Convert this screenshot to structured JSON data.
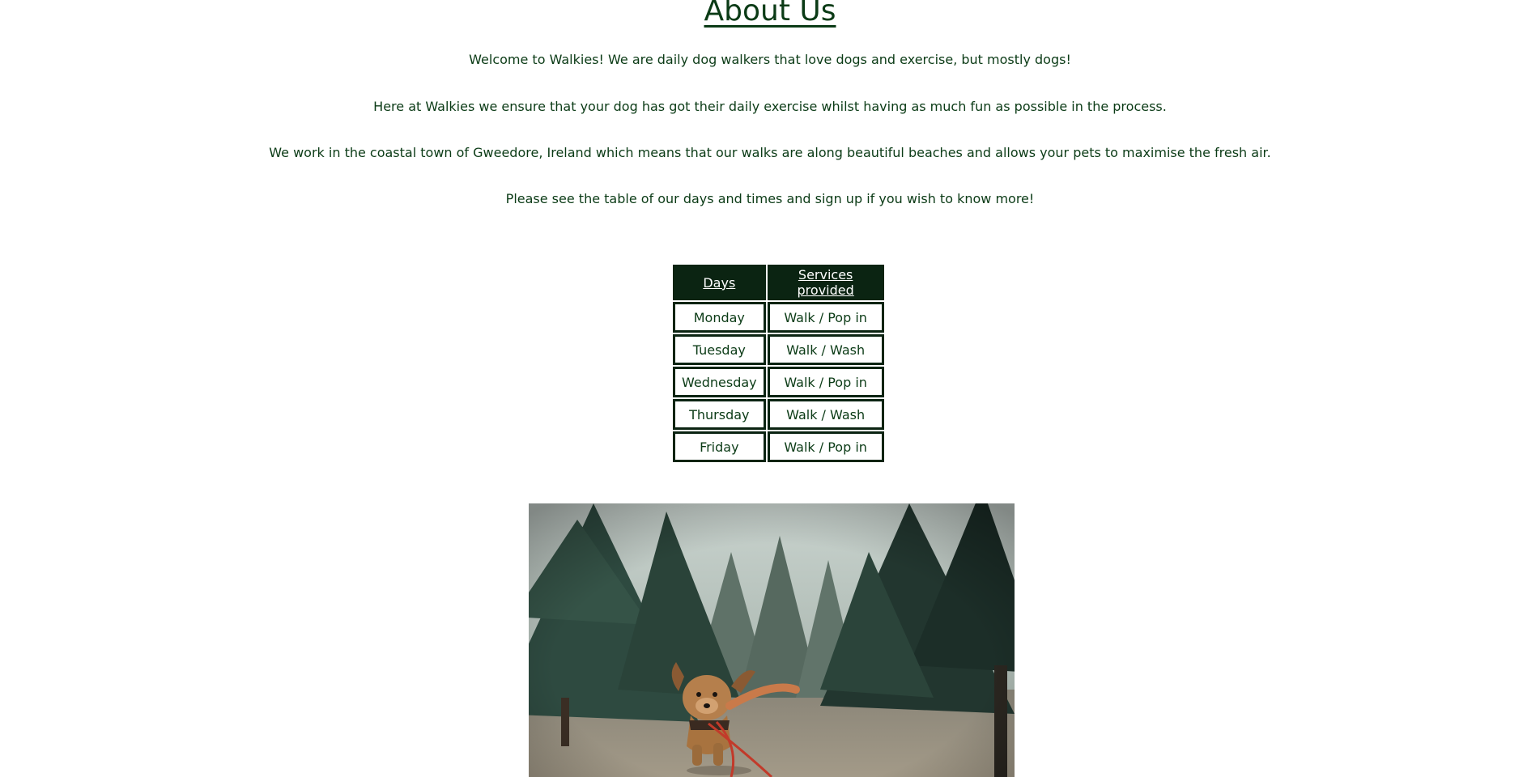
{
  "page": {
    "title": "About Us",
    "paragraphs": [
      "Welcome to Walkies! We are daily dog walkers that love dogs and exercise, but mostly dogs!",
      "Here at Walkies we ensure that your dog has got their daily exercise whilst having as much fun as possible in the process.",
      "We work in the coastal town of Gweedore, Ireland which means that our walks are along beautiful beaches and allows your pets to maximise the fresh air.",
      "Please see the table of our days and times and sign up if you wish to know more!"
    ]
  },
  "schedule": {
    "headers": [
      "Days",
      "Services provided"
    ],
    "rows": [
      {
        "day": "Monday",
        "service": "Walk / Pop in"
      },
      {
        "day": "Tuesday",
        "service": "Walk / Wash"
      },
      {
        "day": "Wednesday",
        "service": "Walk / Pop in"
      },
      {
        "day": "Thursday",
        "service": "Walk / Wash"
      },
      {
        "day": "Friday",
        "service": "Walk / Pop in"
      }
    ]
  },
  "colors": {
    "text": "#0b3b16",
    "table_header_bg": "#0b2412",
    "table_border": "#0b2412"
  }
}
